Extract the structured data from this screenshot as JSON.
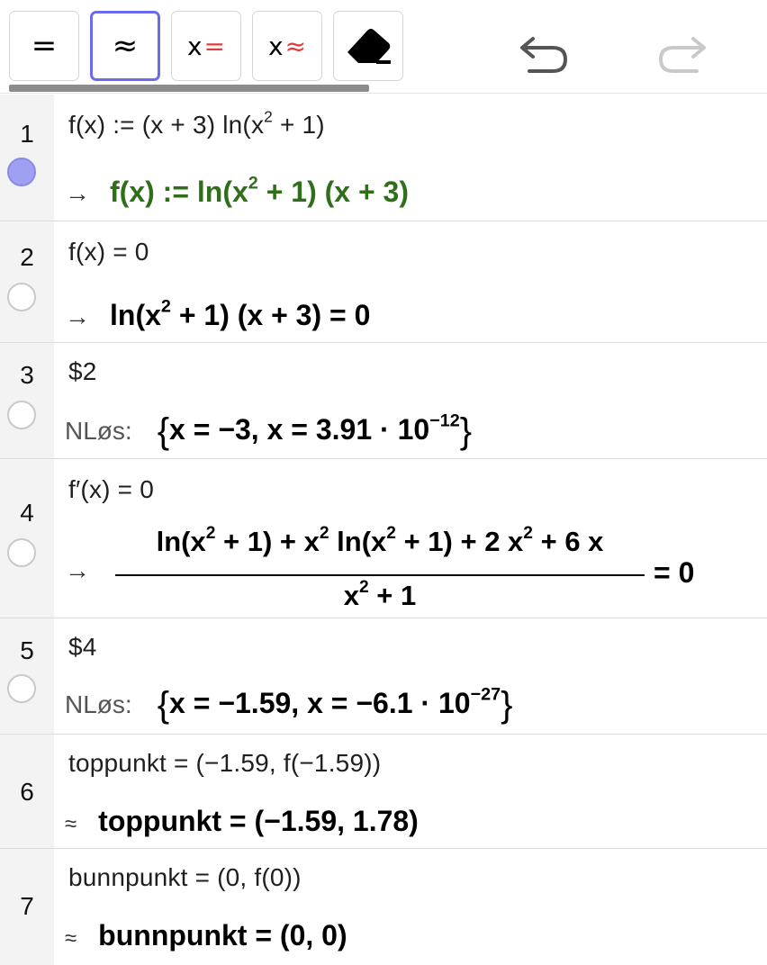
{
  "toolbar": {
    "buttons": [
      {
        "label": "=",
        "tooltip": ""
      },
      {
        "label": "≈",
        "tooltip": ""
      },
      {
        "x": "x",
        "sym": "="
      },
      {
        "x": "x",
        "sym": "≈"
      }
    ],
    "eraser_icon": "eraser-icon",
    "undo_icon": "undo-icon",
    "redo_icon": "redo-icon",
    "active_index": 1,
    "accent_color": "#6b6bf0"
  },
  "rows": [
    {
      "num": "1",
      "marble_on": true,
      "input": "f(x) := (x + 3)  ln(x² + 1)",
      "input_parts": [
        "f(x) := (x + 3)  ln(x",
        "2",
        " + 1)"
      ],
      "output_prefix": "→",
      "output_parts": [
        "f(x) := ln(x",
        "2",
        " + 1) (x + 3)"
      ],
      "output_color": "#2f6f1a"
    },
    {
      "num": "2",
      "marble_on": false,
      "input": "f(x) = 0",
      "output_prefix": "→",
      "output_parts": [
        "ln(x",
        "2",
        " + 1) (x + 3) = 0"
      ]
    },
    {
      "num": "3",
      "marble_on": false,
      "input": "$2",
      "output_label": "NLøs:",
      "output_parts": [
        "x = −3, x = 3.91 · 10",
        "−12"
      ]
    },
    {
      "num": "4",
      "marble_on": false,
      "input": "f′(x) = 0",
      "output_prefix": "→",
      "numerator_parts": [
        "ln(x",
        "2",
        " + 1) + x",
        "2",
        "  ln(x",
        "2",
        " + 1) + 2 x",
        "2",
        " + 6 x"
      ],
      "denominator_parts": [
        "x",
        "2",
        " + 1"
      ],
      "output_suffix": "= 0"
    },
    {
      "num": "5",
      "marble_on": false,
      "input": "$4",
      "output_label": "NLøs:",
      "output_parts": [
        "x = −1.59, x = −6.1 · 10",
        "−27"
      ]
    },
    {
      "num": "6",
      "marble_on": false,
      "input": "toppunkt = (−1.59,  f(−1.59))",
      "output_prefix": "≈",
      "output": "toppunkt = (−1.59,  1.78)"
    },
    {
      "num": "7",
      "marble_on": false,
      "input": "bunnpunkt = (0, f(0))",
      "output_prefix": "≈",
      "output": "bunnpunkt = (0,  0)"
    }
  ]
}
